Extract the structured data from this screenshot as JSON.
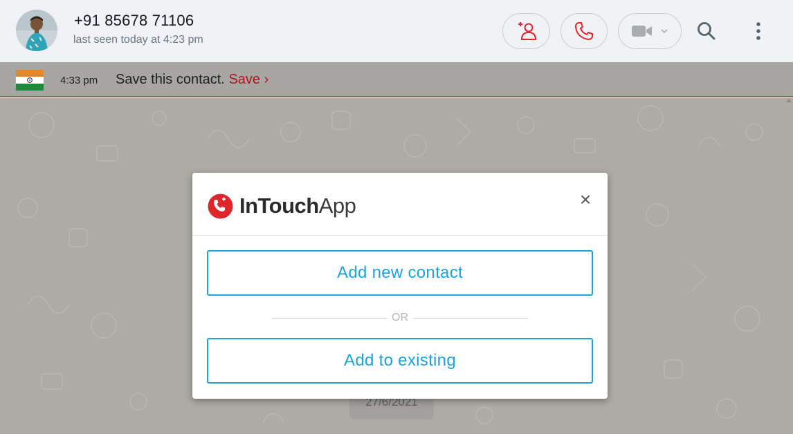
{
  "header": {
    "contact_name": "+91 85678 71106",
    "last_seen": "last seen today at 4:23 pm",
    "buttons": [
      "add-contact-icon",
      "phone-icon",
      "video-camera-icon",
      "search-icon",
      "kebab-menu-icon"
    ]
  },
  "banner": {
    "time": "4:33 pm",
    "message": "Save this contact.",
    "save_label": "Save",
    "save_chevron": "›",
    "flag": "india-flag"
  },
  "chat": {
    "date_chip": "27/6/2021"
  },
  "modal": {
    "logo_bold": "InTouch",
    "logo_light": "App",
    "close_label": "×",
    "add_new_label": "Add new contact",
    "or_label": "OR",
    "add_existing_label": "Add to existing"
  },
  "colors": {
    "accent_red": "#e0262d",
    "button_blue": "#1aa3dd",
    "header_bg": "#f0f2f5",
    "banner_bg": "#a8a6a2"
  }
}
